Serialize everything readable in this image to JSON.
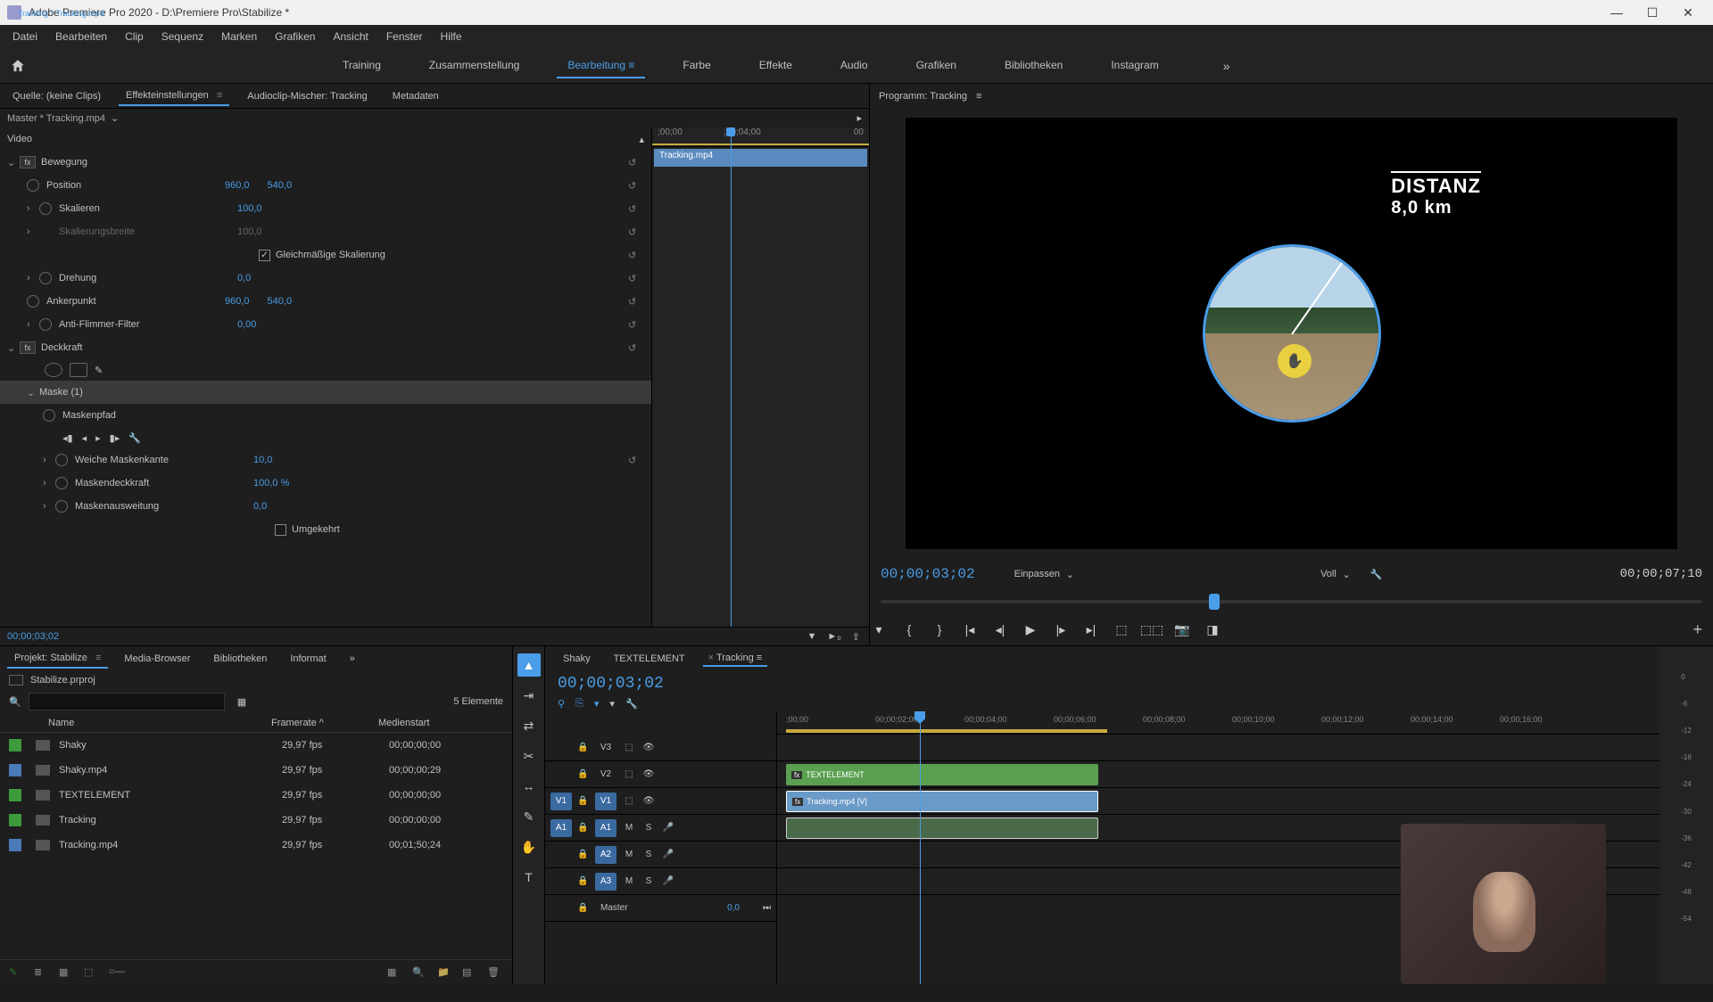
{
  "titlebar": {
    "title": "Adobe Premiere Pro 2020 - D:\\Premiere Pro\\Stabilize *"
  },
  "menubar": [
    "Datei",
    "Bearbeiten",
    "Clip",
    "Sequenz",
    "Marken",
    "Grafiken",
    "Ansicht",
    "Fenster",
    "Hilfe"
  ],
  "workspaces": {
    "items": [
      "Training",
      "Zusammenstellung",
      "Bearbeitung",
      "Farbe",
      "Effekte",
      "Audio",
      "Grafiken",
      "Bibliotheken",
      "Instagram"
    ],
    "active_index": 2
  },
  "source_tabs": {
    "items": [
      "Quelle: (keine Clips)",
      "Effekteinstellungen",
      "Audioclip-Mischer: Tracking",
      "Metadaten"
    ],
    "active_index": 1
  },
  "effect_controls": {
    "master": "Master * Tracking.mp4",
    "clip": "Tracking * Tracking.mp4",
    "timeline_marks": [
      ";00;00",
      ";00;04;00",
      "00"
    ],
    "clipname": "Tracking.mp4",
    "timecode": "00;00;03;02",
    "sections": {
      "video": "Video",
      "bewegung": "Bewegung",
      "deckkraft": "Deckkraft",
      "maske": "Maske (1)"
    },
    "props": {
      "position": {
        "label": "Position",
        "x": "960,0",
        "y": "540,0"
      },
      "skalieren": {
        "label": "Skalieren",
        "v": "100,0"
      },
      "skalierungsbreite": {
        "label": "Skalierungsbreite",
        "v": "100,0"
      },
      "gleichm": "Gleichmäßige Skalierung",
      "drehung": {
        "label": "Drehung",
        "v": "0,0"
      },
      "ankerpunkt": {
        "label": "Ankerpunkt",
        "x": "960,0",
        "y": "540,0"
      },
      "antiflimmer": {
        "label": "Anti-Flimmer-Filter",
        "v": "0,00"
      },
      "maskenpfad": "Maskenpfad",
      "weiche": {
        "label": "Weiche Maskenkante",
        "v": "10,0"
      },
      "maskendeck": {
        "label": "Maskendeckkraft",
        "v": "100,0 %"
      },
      "maskenausw": {
        "label": "Maskenausweitung",
        "v": "0,0"
      },
      "umgekehrt": "Umgekehrt"
    }
  },
  "program": {
    "title": "Programm: Tracking",
    "overlay_title": "DISTANZ",
    "overlay_value": "8,0 km",
    "timecode": "00;00;03;02",
    "zoom": "Einpassen",
    "resolution": "Voll",
    "duration": "00;00;07;10"
  },
  "project": {
    "tabs": [
      "Projekt: Stabilize",
      "Media-Browser",
      "Bibliotheken",
      "Informat"
    ],
    "file": "Stabilize.prproj",
    "count": "5 Elemente",
    "cols": {
      "name": "Name",
      "framerate": "Framerate",
      "medienstart": "Medienstart"
    },
    "items": [
      {
        "swatch": "green",
        "name": "Shaky",
        "fr": "29,97 fps",
        "start": "00;00;00;00"
      },
      {
        "swatch": "blue",
        "name": "Shaky.mp4",
        "fr": "29,97 fps",
        "start": "00;00;00;29"
      },
      {
        "swatch": "green",
        "name": "TEXTELEMENT",
        "fr": "29,97 fps",
        "start": "00;00;00;00"
      },
      {
        "swatch": "green",
        "name": "Tracking",
        "fr": "29,97 fps",
        "start": "00;00;00;00"
      },
      {
        "swatch": "blue",
        "name": "Tracking.mp4",
        "fr": "29,97 fps",
        "start": "00;01;50;24"
      }
    ]
  },
  "timeline": {
    "tabs": [
      "Shaky",
      "TEXTELEMENT",
      "Tracking"
    ],
    "active_index": 2,
    "timecode": "00;00;03;02",
    "ruler": [
      ";00;00",
      "00;00;02;00",
      "00;00;04;00",
      "00;00;06;00",
      "00;00;08;00",
      "00;00;10;00",
      "00;00;12;00",
      "00;00;14;00",
      "00;00;16;00"
    ],
    "tracks": {
      "v3": "V3",
      "v2": "V2",
      "v1": "V1",
      "a1": "A1",
      "a2": "A2",
      "a3": "A3",
      "v1src": "V1",
      "a1src": "A1",
      "master": "Master",
      "master_val": "0,0",
      "mute": "M",
      "solo": "S"
    },
    "clips": {
      "text": "TEXTELEMENT",
      "video": "Tracking.mp4 [V]"
    }
  },
  "audio_meter_scale": [
    "0",
    "-6",
    "-12",
    "-18",
    "-24",
    "-30",
    "-36",
    "-42",
    "-48",
    "-54"
  ]
}
